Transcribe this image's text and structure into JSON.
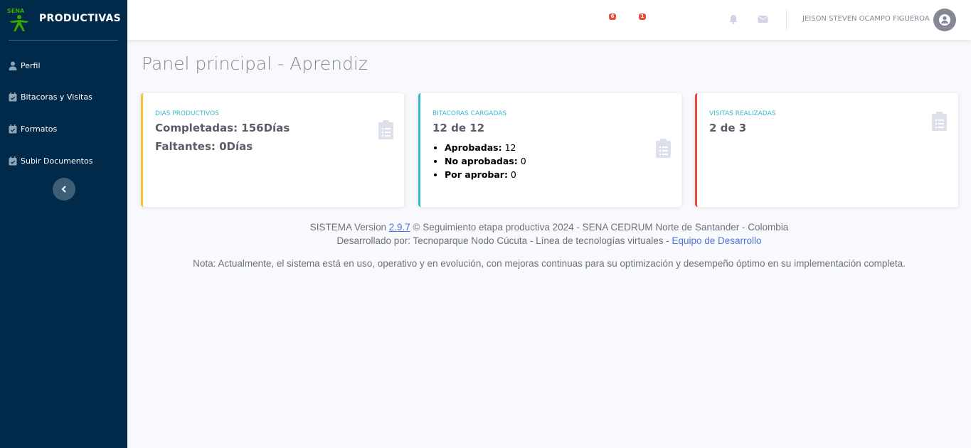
{
  "brand": {
    "logo_text": "SENA",
    "name": "PRODUCTIVAS"
  },
  "sidebar": {
    "items": [
      {
        "label": "Perfil",
        "icon": "user-icon"
      },
      {
        "label": "Bitacoras y Visitas",
        "icon": "calendar-icon"
      },
      {
        "label": "Formatos",
        "icon": "calendar-icon"
      },
      {
        "label": "Subir Documentos",
        "icon": "calendar-icon"
      }
    ],
    "toggle_icon": "chevron-left-icon"
  },
  "topbar": {
    "bell_count": "6",
    "mail_count": "1",
    "user_name": "JEISON STEVEN OCAMPO FIGUEROA"
  },
  "main": {
    "title": "Panel principal - Aprendiz",
    "cards": [
      {
        "title": "DIAS PRODUCTIVOS",
        "line1": "Completadas: 156Días",
        "line2": "Faltantes: 0Días",
        "icon": "clipboard-list-icon"
      },
      {
        "title": "BITACORAS CARGADAS",
        "line1": "12 de 12",
        "items": [
          {
            "label": "Aprobadas:",
            "value": " 12"
          },
          {
            "label": "No aprobadas:",
            "value": " 0"
          },
          {
            "label": "Por aprobar:",
            "value": " 0"
          }
        ],
        "icon": "clipboard-list-icon"
      },
      {
        "title": "VISITAS REALIZADAS",
        "line1": "2 de 3",
        "icon": "clipboard-list-icon"
      }
    ]
  },
  "footer": {
    "line1_prefix": "SISTEMA Version ",
    "version": "2.9.7",
    "line1_suffix": " © Seguimiento etapa productiva 2024 - SENA CEDRUM Norte de Santander - Colombia",
    "line2_prefix": "Desarrollado por: Tecnoparque Nodo Cúcuta - Línea de tecnologías virtuales - ",
    "line2_link": "Equipo de Desarrollo",
    "note": "Nota: Actualmente, el sistema está en uso, operativo y en evolución, con mejoras continuas para su optimización y desempeño óptimo en su implementación completa."
  },
  "colors": {
    "sidebar_bg": "#012a4a",
    "accent_yellow": "#f6c23e",
    "accent_cyan": "#36b9cc",
    "accent_red": "#e74a3b",
    "link": "#4e73df"
  }
}
